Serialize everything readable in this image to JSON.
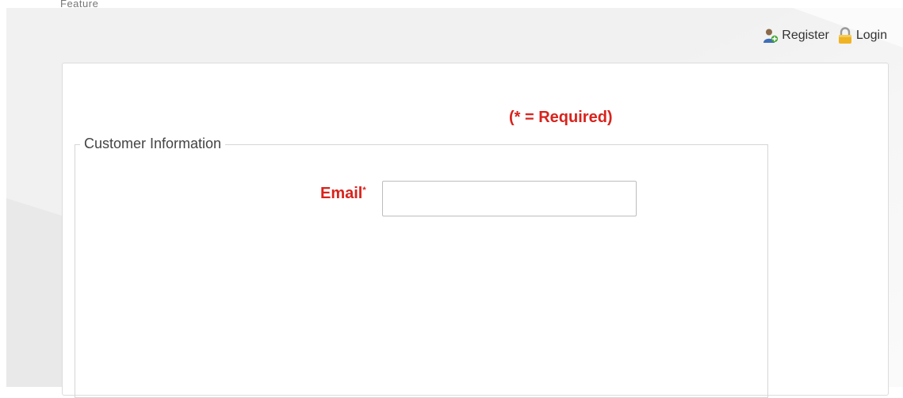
{
  "header": {
    "crumb_text": "Feature",
    "register_label": "Register",
    "login_label": "Login",
    "register_icon": "user-add-icon",
    "login_icon": "lock-icon"
  },
  "form": {
    "required_note": "(* = Required)",
    "section_legend": "Customer Information",
    "email_label": "Email",
    "required_marker": "*",
    "email_value": "",
    "email_placeholder": ""
  },
  "colors": {
    "required_red": "#d8231c",
    "page_bg": "#f1f1f1",
    "card_bg": "#ffffff"
  }
}
